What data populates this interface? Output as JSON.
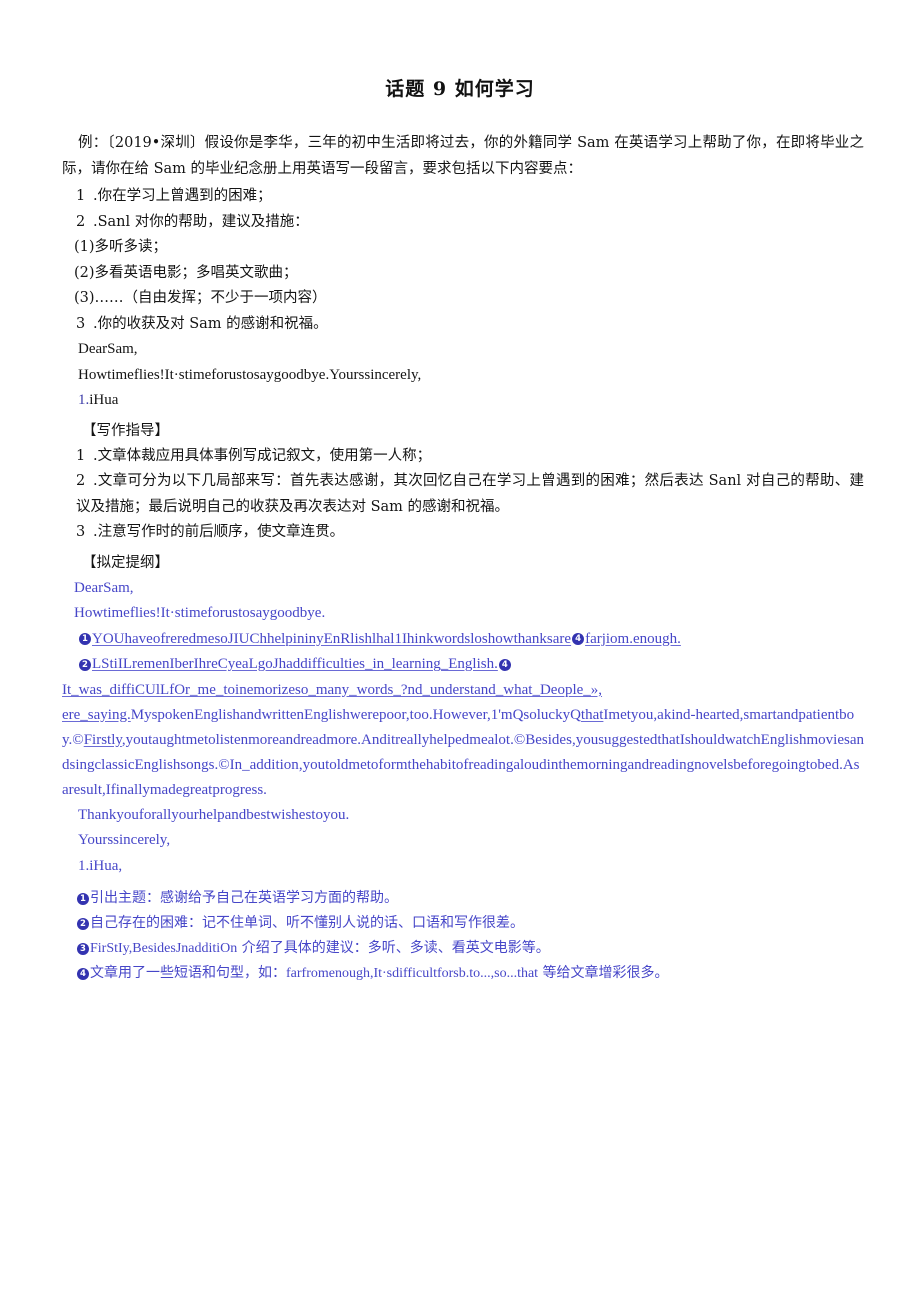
{
  "document": {
    "title": "话题 9 如何学习"
  },
  "prompt": {
    "text": "例：〔2019•深圳〕假设你是李华，三年的初中生活即将过去，你的外籍同学 Sam 在英语学习上帮助了你，在即将毕业之际，请你在给 Sam 的毕业纪念册上用英语写一段留言，要求包括以下内容要点："
  },
  "requirements": [
    {
      "num": "1",
      "text": ".你在学习上曾遇到的困难；"
    },
    {
      "num": "2",
      "text": ".Sanl 对你的帮助，建议及措施："
    }
  ],
  "sub_requirements": [
    "(1)多听多读；",
    "(2)多看英语电影；多唱英文歌曲；",
    "(3)……（自由发挥；不少于一项内容）"
  ],
  "requirement_last": {
    "num": "3",
    "text": ".你的收获及对 Sam 的感谢和祝福。"
  },
  "sample_letter": {
    "greeting": "DearSam,",
    "body": "Howtimeflies!It·stimeforustosaygoodbye.Yourssincerely,",
    "signature_prefix": "1.",
    "signature": "iHua"
  },
  "guidance": {
    "heading": "【写作指导】",
    "items": [
      {
        "num": "1",
        "text": ".文章体裁应用具体事例写成记叙文，使用第一人称；"
      },
      {
        "num": "2",
        "text": ".文章可分为以下几局部来写：首先表达感谢，其次回忆自己在学习上曾遇到的困难；然后表达 Sanl 对自己的帮助、建议及措施；最后说明自己的收获及再次表达对 Sam 的感谢和祝福。"
      },
      {
        "num": "3",
        "text": ".注意写作时的前后顺序，使文章连贯。"
      }
    ]
  },
  "outline": {
    "heading": "【拟定提纲】",
    "greeting": "DearSam,",
    "opening": "Howtimeflies!It·stimeforustosaygoodbye.",
    "line1_a": "YOUhaveofreredmesoJIUChhelpininyEnRlishlhal1Ihinkwordsloshowthanksare",
    "line1_b": "farjiom.enough.",
    "line2": "LStiILremenIberIhreCyeaLgoJhaddifficulties_in_learning_English.",
    "para_a": "It_was_diffiCUlLfOr_me_toinemorizeso_many_words_?nd_understand_what_Deople_»,",
    "para_b": "ere_saying.",
    "para_c": "MyspokenEnglishandwrittenEnglishwerepoor,too.However,1'mQsoluckyQ",
    "para_d": "that",
    "para_e": "Imetyou,akind-hearted,smartandpatientboy.",
    "marker_firstly": "©",
    "firstly": "Firstly",
    "para_f": ",youtaughtmetolistenmoreandreadmore.Anditreallyhelpedmealot.",
    "marker_besides": "©",
    "besides": "Besides",
    "para_g": ",yousuggestedthatIshouldwatchEnglishmoviesandsingclassicEnglishsongs.",
    "marker_inaddition": "©",
    "inaddition": "In_addition",
    "para_h": ",youtoldmetoformthehabitofreadingaloudinthemorningandreadingnovelsbeforegoingtobed.Asaresult,Ifinallymadegreatprogress.",
    "thanks": "Thankyouforallyourhelpandbestwishestoyou.",
    "closing": "Yourssincerely,",
    "signature_prefix": "1.",
    "signature": "iHua,"
  },
  "notes": [
    {
      "marker": "1",
      "text": "引出主题：感谢给予自己在英语学习方面的帮助。"
    },
    {
      "marker": "2",
      "text": "自己存在的困难：记不住单词、听不懂别人说的话、口语和写作很差。"
    },
    {
      "marker": "3",
      "text_en": "FirStIy,BesidesJnadditiOn",
      "text": " 介绍了具体的建议：多听、多读、看英文电影等。"
    },
    {
      "marker": "4",
      "text_pre": "文章用了一些短语和句型，如：",
      "text_en": "farfromenough,It·sdifficultforsb.to...,so...that",
      "text": " 等给文章增彩很多。"
    }
  ],
  "colors": {
    "ink_black": "#141414",
    "ink_blue": "#4646c8",
    "marker_blue": "#3333b0"
  }
}
